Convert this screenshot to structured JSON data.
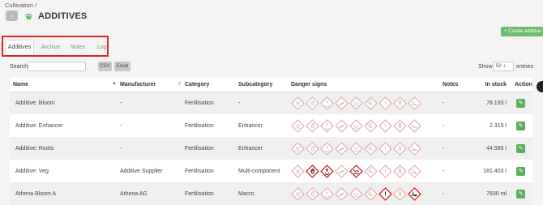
{
  "breadcrumb": "Cultivation /",
  "page_title": "ADDITIVES",
  "create_label": "+ Create additive",
  "tabs": [
    "Additives",
    "Archive",
    "Notes",
    "Log"
  ],
  "search_label": "Search",
  "csv_label": "CSV",
  "excel_label": "Excel",
  "show_label": "Show",
  "show_value": "50",
  "entries_label": "entries",
  "columns": [
    "Name",
    "Manufacturer",
    "Category",
    "Subcategory",
    "Danger signs",
    "Notes",
    "In stock",
    "Action"
  ],
  "rows": [
    {
      "name": "Additive: Bloom",
      "manufacturer": "-",
      "category": "Fertilisation",
      "subcategory": "-",
      "notes": "-",
      "stock": "78.193 l",
      "active": []
    },
    {
      "name": "Additive: Enhancer",
      "manufacturer": "-",
      "category": "Fertilisation",
      "subcategory": "Enhancer",
      "notes": "-",
      "stock": "2.315 l",
      "active": []
    },
    {
      "name": "Additive: Roots",
      "manufacturer": "-",
      "category": "Fertilisation",
      "subcategory": "Enhancer",
      "notes": "-",
      "stock": "44.585 l",
      "active": []
    },
    {
      "name": "Additive: Veg",
      "manufacturer": "Additive Supplier",
      "category": "Fertilisation",
      "subcategory": "Multi-component",
      "notes": "-",
      "stock": "181.403 l",
      "active": [
        1,
        2,
        4
      ]
    },
    {
      "name": "Athena Bloom A",
      "manufacturer": "Athena AG",
      "category": "Fertilisation",
      "subcategory": "Macro",
      "notes": "-",
      "stock": "7830 ml",
      "active": [
        6,
        8
      ]
    }
  ],
  "hazard_icons": [
    "explosive-icon",
    "flame-icon",
    "oxidizer-icon",
    "gas-cylinder-icon",
    "corrosive-icon",
    "skull-icon",
    "exclamation-icon",
    "health-hazard-icon",
    "environment-icon"
  ],
  "colors": {
    "accent": "#6fbb6f",
    "hazard": "#d22",
    "highlight": "#e02424"
  }
}
